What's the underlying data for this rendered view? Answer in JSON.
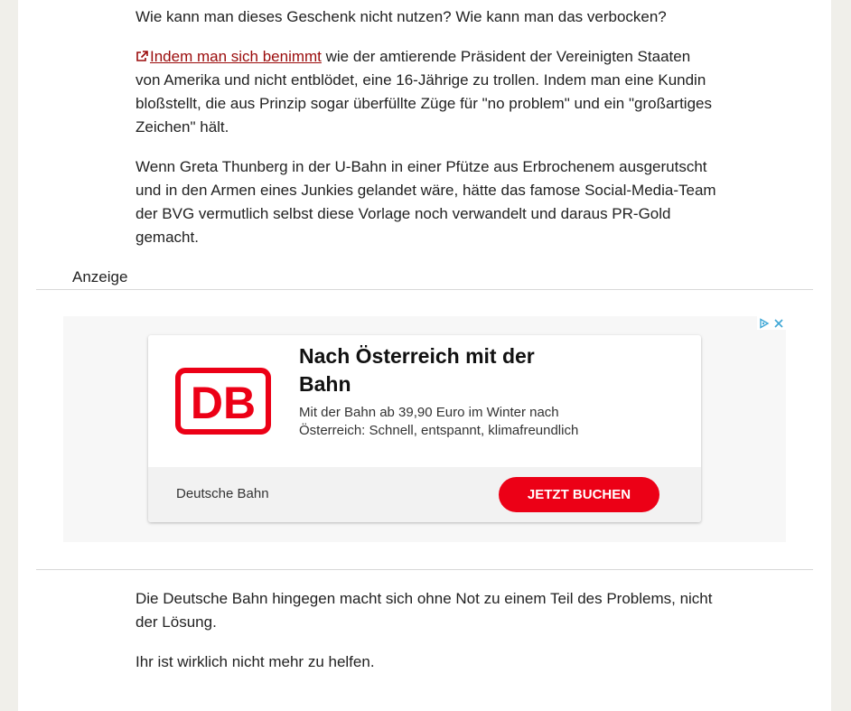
{
  "article": {
    "p1": "Wie kann man dieses Geschenk nicht nutzen? Wie kann man das verbocken?",
    "p2_link": "Indem man sich benimmt",
    "p2_rest": " wie der amtierende Präsident der Vereinigten Staaten von Amerika und nicht entblödet, eine 16-Jährige zu trollen. Indem man eine Kundin bloßstellt, die aus Prinzip sogar überfüllte Züge für \"no problem\" und ein \"großartiges Zeichen\" hält.",
    "p3": "Wenn Greta Thunberg in der U-Bahn in einer Pfütze aus Erbrochenem ausgerutscht und in den Armen eines Junkies gelandet wäre, hätte das famose Social-Media-Team der BVG vermutlich selbst diese Vorlage noch verwandelt und daraus PR-Gold gemacht.",
    "p4": "Die Deutsche Bahn hingegen macht sich ohne Not zu einem Teil des Problems, nicht der Lösung.",
    "p5": "Ihr ist wirklich nicht mehr zu helfen."
  },
  "ad": {
    "label": "Anzeige",
    "title": "Nach Österreich mit der Bahn",
    "description": "Mit der Bahn ab 39,90 Euro im Winter nach Österreich: Schnell, entspannt, klimafreundlich",
    "advertiser": "Deutsche Bahn",
    "cta": "JETZT BUCHEN",
    "logo_text": "DB",
    "brand_color": "#ec0016"
  },
  "icons": {
    "external_link": "external-link-icon",
    "adchoices": "adchoices-icon",
    "close": "close-icon"
  }
}
